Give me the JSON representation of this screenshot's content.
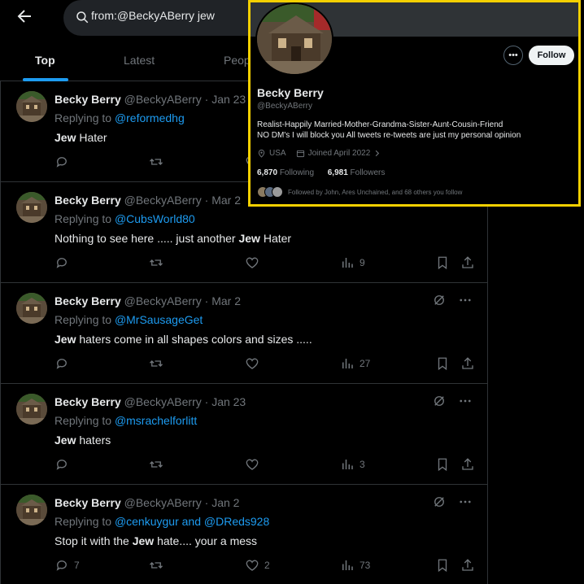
{
  "header": {
    "search_value": "from:@BeckyABerry jew",
    "tabs": [
      {
        "label": "Top",
        "active": true
      },
      {
        "label": "Latest",
        "active": false
      },
      {
        "label": "Peop",
        "active": false
      }
    ]
  },
  "icons": {
    "back": "arrow-left-icon",
    "search": "search-icon",
    "reply": "reply-icon",
    "retweet": "retweet-icon",
    "like": "heart-icon",
    "views": "bar-chart-icon",
    "bookmark": "bookmark-icon",
    "share": "share-icon",
    "grok": "grok-icon",
    "more": "more-dots-icon"
  },
  "colors": {
    "background": "#000000",
    "text": "#e7e9ea",
    "muted": "#71767b",
    "accent": "#1d9bf0",
    "highlight_border": "#f4d000"
  },
  "tweets": [
    {
      "name": "Becky Berry",
      "meta": "@BeckyABerry · Jan 23",
      "replying_prefix": "Replying to ",
      "mention": "@reformedhg",
      "body_bold": "Jew",
      "body_rest": " Hater",
      "body_pre": "",
      "replies": "",
      "likes": "",
      "views": ""
    },
    {
      "name": "Becky Berry",
      "meta": "@BeckyABerry · Mar 2",
      "replying_prefix": "Replying to ",
      "mention": "@CubsWorld80",
      "body_pre": "Nothing to see here ..... just another ",
      "body_bold": "Jew",
      "body_rest": " Hater",
      "replies": "",
      "likes": "",
      "views": "9"
    },
    {
      "name": "Becky Berry",
      "meta": "@BeckyABerry · Mar 2",
      "replying_prefix": "Replying to ",
      "mention": "@MrSausageGet",
      "body_pre": "",
      "body_bold": "Jew",
      "body_rest": " haters come in all shapes colors and sizes .....",
      "replies": "",
      "likes": "",
      "views": "27"
    },
    {
      "name": "Becky Berry",
      "meta": "@BeckyABerry · Jan 23",
      "replying_prefix": "Replying to ",
      "mention": "@msrachelforlitt",
      "body_pre": "",
      "body_bold": "Jew",
      "body_rest": " haters",
      "replies": "",
      "likes": "",
      "views": "3"
    },
    {
      "name": "Becky Berry",
      "meta": "@BeckyABerry · Jan 2",
      "replying_prefix": "Replying to ",
      "mention": "@cenkuygur and @DReds928",
      "body_pre": "Stop it with the ",
      "body_bold": "Jew",
      "body_rest": " hate.... your a mess",
      "replies": "7",
      "likes": "2",
      "views": "73"
    }
  ],
  "profile_card": {
    "name": "Becky Berry",
    "handle": "@BeckyABerry",
    "follow_label": "Follow",
    "more_label": "•••",
    "bio_line1": "Realist-Happily Married-Mother-Grandma-Sister-Aunt-Cousin-Friend",
    "bio_line2": "NO DM's I will block you All tweets re-tweets are just my personal opinion",
    "location": "USA",
    "joined": "Joined April 2022",
    "following_count": "6,870",
    "following_label": "Following",
    "followers_count": "6,981",
    "followers_label": "Followers",
    "followed_by": "Followed by John, Ares Unchained, and 68 others you follow"
  }
}
